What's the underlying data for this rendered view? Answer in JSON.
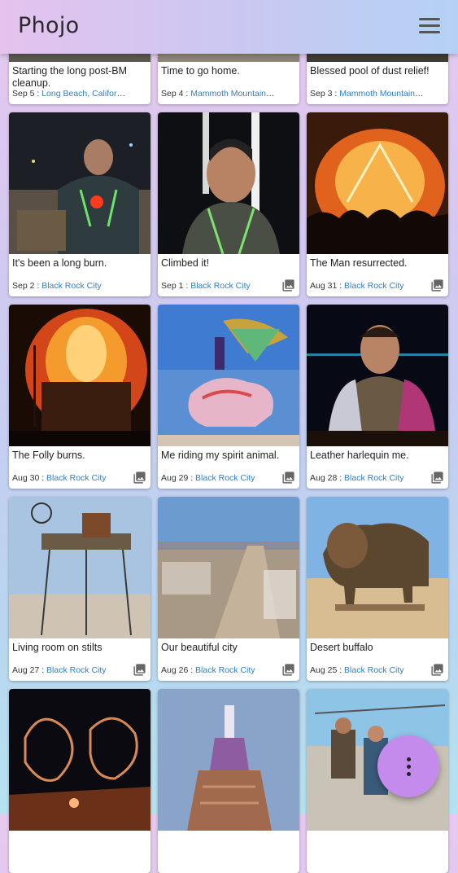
{
  "app": {
    "title": "Phojo"
  },
  "cards": [
    {
      "caption": "Starting the long post-BM cleanup.",
      "date": "Sep 5",
      "location": "Long Beach, California, USA"
    },
    {
      "caption": "Time to go home.",
      "date": "Sep 4",
      "location": "Mammoth Mountain RV Pa..."
    },
    {
      "caption": "Blessed pool of dust relief!",
      "date": "Sep 3",
      "location": "Mammoth Mountain RV Pa..."
    },
    {
      "caption": "It's been a long burn.",
      "date": "Sep 2",
      "location": "Black Rock City"
    },
    {
      "caption": "Climbed it!",
      "date": "Sep 1",
      "location": "Black Rock City"
    },
    {
      "caption": "The Man resurrected.",
      "date": "Aug 31",
      "location": "Black Rock City"
    },
    {
      "caption": "The Folly burns.",
      "date": "Aug 30",
      "location": "Black Rock City"
    },
    {
      "caption": "Me riding my spirit animal.",
      "date": "Aug 29",
      "location": "Black Rock City"
    },
    {
      "caption": "Leather harlequin me.",
      "date": "Aug 28",
      "location": "Black Rock City"
    },
    {
      "caption": "Living room on stilts",
      "date": "Aug 27",
      "location": "Black Rock City"
    },
    {
      "caption": "Our beautiful city",
      "date": "Aug 26",
      "location": "Black Rock City"
    },
    {
      "caption": "Desert buffalo",
      "date": "Aug 25",
      "location": "Black Rock City"
    },
    {
      "caption": "",
      "date": "",
      "location": ""
    },
    {
      "caption": "",
      "date": "",
      "location": ""
    },
    {
      "caption": "",
      "date": "",
      "location": ""
    }
  ],
  "separator": " : ",
  "icons": {
    "menu": "hamburger-icon",
    "gallery": "gallery-icon",
    "fab": "more-vert-icon"
  },
  "colors": {
    "accent": "#c58bec",
    "link": "#2f7fc8"
  }
}
